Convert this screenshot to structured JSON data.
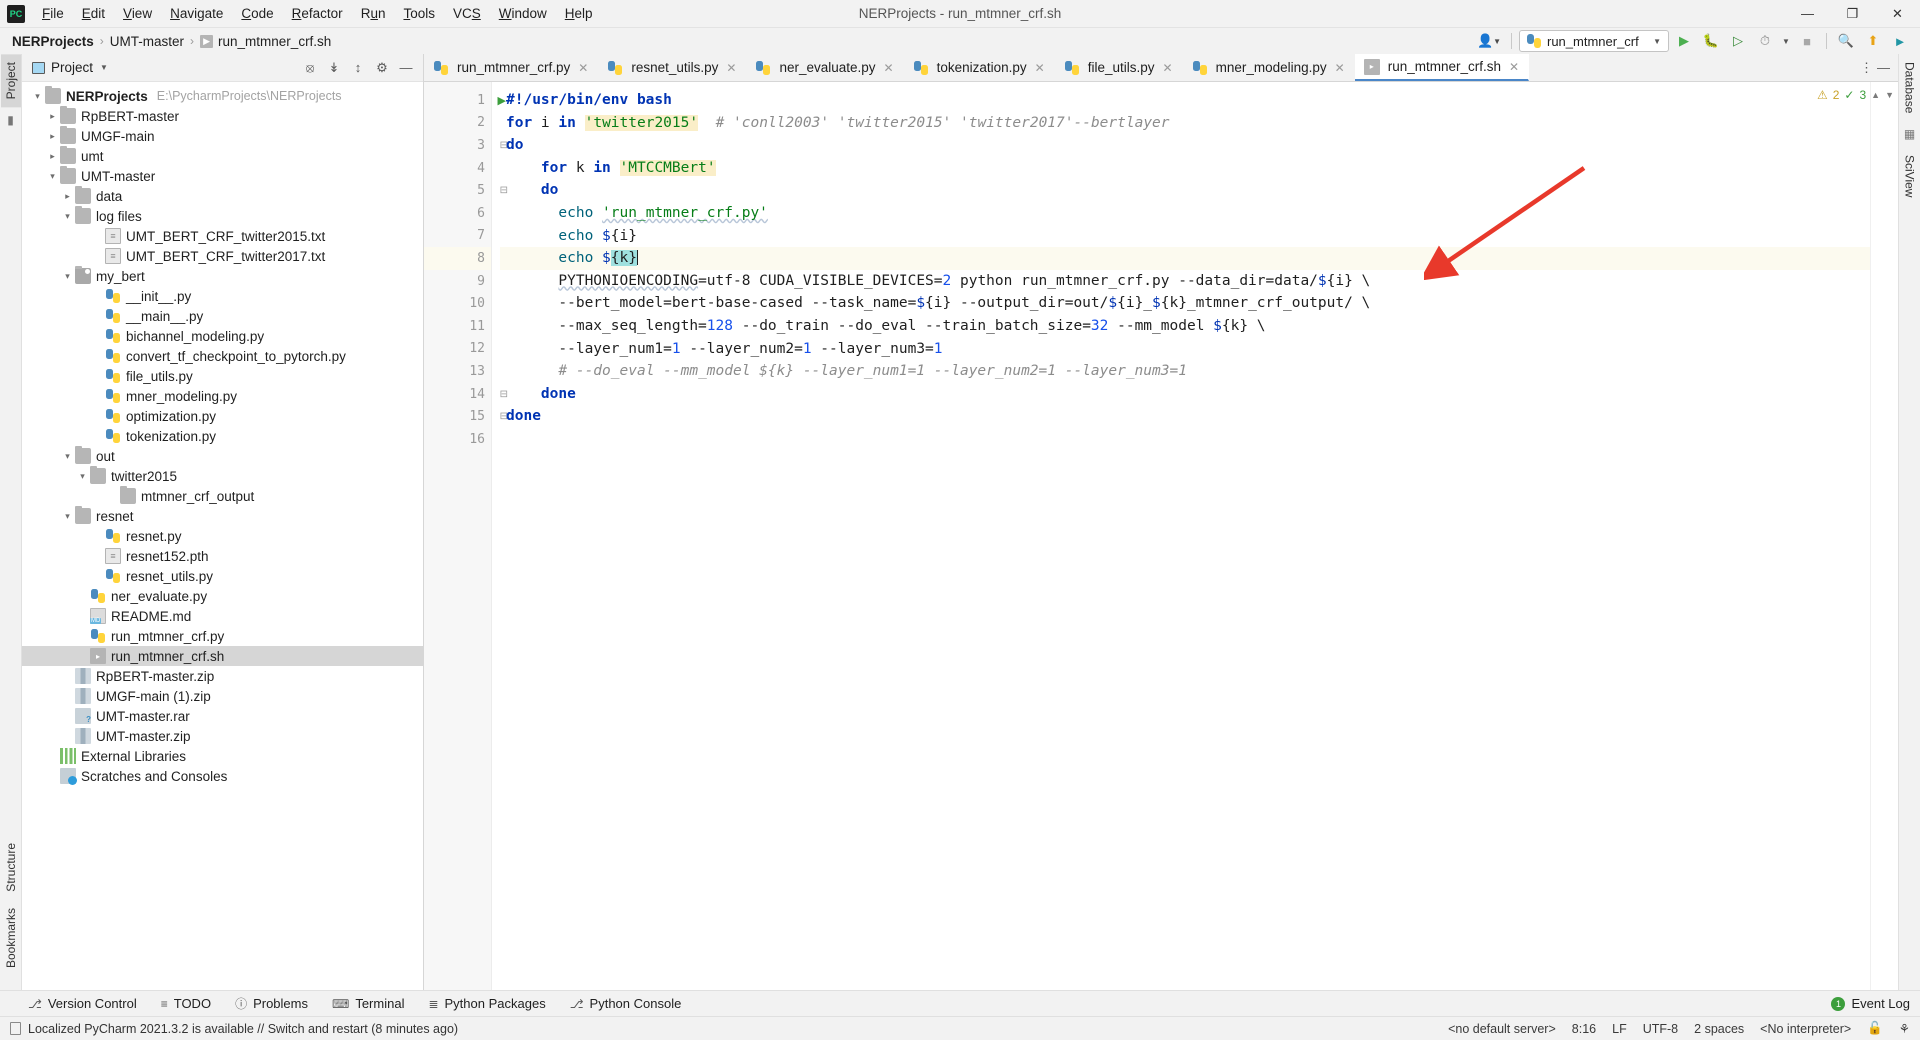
{
  "titlebar": {
    "logo": "pycharm-logo",
    "menus": [
      "File",
      "Edit",
      "View",
      "Navigate",
      "Code",
      "Refactor",
      "Run",
      "Tools",
      "VCS",
      "Window",
      "Help"
    ],
    "window_title": "NERProjects - run_mtmner_crf.sh",
    "minimize": "—",
    "maximize": "❐",
    "close": "✕"
  },
  "navbar": {
    "crumbs": [
      "NERProjects",
      "UMT-master",
      "run_mtmner_crf.sh"
    ],
    "separator": "›",
    "run_config": "run_mtmner_crf",
    "icons": {
      "account": "account-icon",
      "dropdown": "chevron-down-icon",
      "run": "▶",
      "debug": "bug-icon",
      "run_coverage": "run-with-coverage-icon",
      "profile": "profiler-icon",
      "stop": "■",
      "search": "⌕",
      "update": "update-icon",
      "settings": "settings-icon"
    }
  },
  "left_rail": {
    "project_tab": "Project",
    "structure_tab": "Structure",
    "bookmarks_tab": "Bookmarks"
  },
  "right_rail": {
    "database_tab": "Database",
    "sciview_tab": "SciView"
  },
  "project_panel": {
    "title": "Project",
    "actions": [
      "locate-icon",
      "expand-all-icon",
      "collapse-all-icon",
      "settings-icon",
      "hide-icon"
    ],
    "tree": [
      {
        "label": "NERProjects",
        "path": "E:\\PycharmProjects\\NERProjects",
        "indent": 0,
        "arrow": "down",
        "icon": "folder",
        "bold": true
      },
      {
        "label": "RpBERT-master",
        "indent": 1,
        "arrow": "right",
        "icon": "folder"
      },
      {
        "label": "UMGF-main",
        "indent": 1,
        "arrow": "right",
        "icon": "folder"
      },
      {
        "label": "umt",
        "indent": 1,
        "arrow": "right",
        "icon": "folder"
      },
      {
        "label": "UMT-master",
        "indent": 1,
        "arrow": "down",
        "icon": "folder"
      },
      {
        "label": "data",
        "indent": 2,
        "arrow": "right",
        "icon": "folder"
      },
      {
        "label": "log files",
        "indent": 2,
        "arrow": "down",
        "icon": "folder"
      },
      {
        "label": "UMT_BERT_CRF_twitter2015.txt",
        "indent": 4,
        "arrow": "none",
        "icon": "txt"
      },
      {
        "label": "UMT_BERT_CRF_twitter2017.txt",
        "indent": 4,
        "arrow": "none",
        "icon": "txt"
      },
      {
        "label": "my_bert",
        "indent": 2,
        "arrow": "down",
        "icon": "folder-src"
      },
      {
        "label": "__init__.py",
        "indent": 4,
        "arrow": "none",
        "icon": "py"
      },
      {
        "label": "__main__.py",
        "indent": 4,
        "arrow": "none",
        "icon": "py"
      },
      {
        "label": "bichannel_modeling.py",
        "indent": 4,
        "arrow": "none",
        "icon": "py"
      },
      {
        "label": "convert_tf_checkpoint_to_pytorch.py",
        "indent": 4,
        "arrow": "none",
        "icon": "py"
      },
      {
        "label": "file_utils.py",
        "indent": 4,
        "arrow": "none",
        "icon": "py"
      },
      {
        "label": "mner_modeling.py",
        "indent": 4,
        "arrow": "none",
        "icon": "py"
      },
      {
        "label": "optimization.py",
        "indent": 4,
        "arrow": "none",
        "icon": "py"
      },
      {
        "label": "tokenization.py",
        "indent": 4,
        "arrow": "none",
        "icon": "py"
      },
      {
        "label": "out",
        "indent": 2,
        "arrow": "down",
        "icon": "folder"
      },
      {
        "label": "twitter2015",
        "indent": 3,
        "arrow": "down",
        "icon": "folder"
      },
      {
        "label": "mtmner_crf_output",
        "indent": 5,
        "arrow": "none",
        "icon": "folder"
      },
      {
        "label": "resnet",
        "indent": 2,
        "arrow": "down",
        "icon": "folder"
      },
      {
        "label": "resnet.py",
        "indent": 4,
        "arrow": "none",
        "icon": "py"
      },
      {
        "label": "resnet152.pth",
        "indent": 4,
        "arrow": "none",
        "icon": "txt"
      },
      {
        "label": "resnet_utils.py",
        "indent": 4,
        "arrow": "none",
        "icon": "py"
      },
      {
        "label": "ner_evaluate.py",
        "indent": 3,
        "arrow": "none",
        "icon": "py"
      },
      {
        "label": "README.md",
        "indent": 3,
        "arrow": "none",
        "icon": "md"
      },
      {
        "label": "run_mtmner_crf.py",
        "indent": 3,
        "arrow": "none",
        "icon": "py"
      },
      {
        "label": "run_mtmner_crf.sh",
        "indent": 3,
        "arrow": "none",
        "icon": "sh",
        "selected": true
      },
      {
        "label": "RpBERT-master.zip",
        "indent": 2,
        "arrow": "none",
        "icon": "zip"
      },
      {
        "label": "UMGF-main (1).zip",
        "indent": 2,
        "arrow": "none",
        "icon": "zip"
      },
      {
        "label": "UMT-master.rar",
        "indent": 2,
        "arrow": "none",
        "icon": "rar"
      },
      {
        "label": "UMT-master.zip",
        "indent": 2,
        "arrow": "none",
        "icon": "zip"
      },
      {
        "label": "External Libraries",
        "indent": 1,
        "arrow": "none",
        "icon": "lib"
      },
      {
        "label": "Scratches and Consoles",
        "indent": 1,
        "arrow": "none",
        "icon": "scratch"
      }
    ]
  },
  "editor": {
    "tabs": [
      {
        "label": "run_mtmner_crf.py",
        "icon": "py",
        "active": false
      },
      {
        "label": "resnet_utils.py",
        "icon": "py",
        "active": false
      },
      {
        "label": "ner_evaluate.py",
        "icon": "py",
        "active": false
      },
      {
        "label": "tokenization.py",
        "icon": "py",
        "active": false
      },
      {
        "label": "file_utils.py",
        "icon": "py",
        "active": false
      },
      {
        "label": "mner_modeling.py",
        "icon": "py",
        "active": false
      },
      {
        "label": "run_mtmner_crf.sh",
        "icon": "sh",
        "active": true
      }
    ],
    "tab_close": "✕",
    "more_tabs": "⋮",
    "inspection": {
      "warnings": "2",
      "oks": "3",
      "warn_icon": "warning-icon",
      "ok_icon": "check-icon",
      "up": "▲",
      "down": "▼"
    },
    "line_numbers": [
      "1",
      "2",
      "3",
      "4",
      "5",
      "6",
      "7",
      "8",
      "9",
      "10",
      "11",
      "12",
      "13",
      "14",
      "15",
      "16"
    ],
    "current_line": 8,
    "lines": [
      "#!/usr/bin/env bash",
      "for i in 'twitter2015' # 'conll2003' 'twitter2015' 'twitter2017'--bertlayer",
      "do",
      "    for k in 'MTCCMBert'",
      "    do",
      "      echo 'run_mtmner_crf.py'",
      "      echo ${i}",
      "      echo ${k}",
      "      PYTHONIOENCODING=utf-8 CUDA_VISIBLE_DEVICES=2 python run_mtmner_crf.py --data_dir=data/${i} \\",
      "      --bert_model=bert-base-cased --task_name=${i} --output_dir=out/${i}_${k}_mtmner_crf_output/ \\",
      "      --max_seq_length=128 --do_train --do_eval --train_batch_size=32 --mm_model ${k} \\",
      "      --layer_num1=1 --layer_num2=1 --layer_num3=1",
      "      # --do_eval --mm_model ${k} --layer_num1=1 --layer_num2=1 --layer_num3=1",
      "    done",
      "done",
      ""
    ]
  },
  "tool_windows": {
    "items": [
      {
        "label": "Version Control",
        "icon": "branch-icon"
      },
      {
        "label": "TODO",
        "icon": "list-icon"
      },
      {
        "label": "Problems",
        "icon": "problems-icon"
      },
      {
        "label": "Terminal",
        "icon": "terminal-icon"
      },
      {
        "label": "Python Packages",
        "icon": "packages-icon"
      },
      {
        "label": "Python Console",
        "icon": "python-console-icon"
      }
    ],
    "event_log": "Event Log",
    "event_count": "1"
  },
  "statusbar": {
    "message": "Localized PyCharm 2021.3.2 is available // Switch and restart (8 minutes ago)",
    "doc_icon": "document-icon",
    "right_items": [
      "<no default server>",
      "8:16",
      "LF",
      "UTF-8",
      "2 spaces",
      "<No interpreter>"
    ],
    "lock_icon": "unlocked-icon",
    "notif_icon": "notifications-icon"
  },
  "colors": {
    "accent": "#4a86c8",
    "string_green": "#067d17",
    "keyword_blue": "#0033b3",
    "number_blue": "#1750eb",
    "comment_gray": "#8c8c8c",
    "highlight_yellow": "#faeec8",
    "current_line": "#fcfaef",
    "annotation_red": "#e8392b",
    "selection_gray": "#d6d6d6"
  }
}
